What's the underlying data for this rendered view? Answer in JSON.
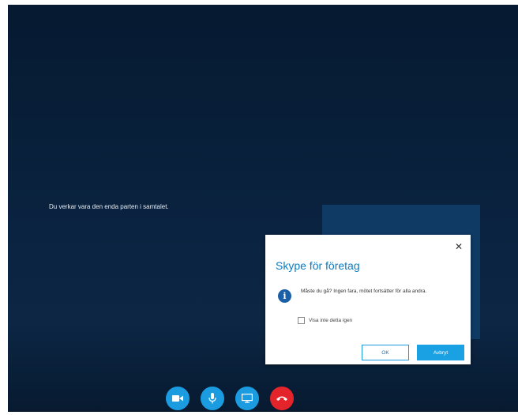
{
  "call": {
    "solo_message": "Du verkar vara den enda parten i samtalet."
  },
  "dialog": {
    "title": "Skype för företag",
    "message": "Måste du gå? Ingen fara, mötet fortsätter för alla andra.",
    "checkbox_label": "Visa inte detta igen",
    "ok_label": "OK",
    "cancel_label": "Avbryt",
    "close_icon": "close-icon",
    "info_icon": "info-icon"
  },
  "controls": {
    "video_icon": "video-camera-icon",
    "mic_icon": "microphone-icon",
    "share_icon": "present-screen-icon",
    "hangup_icon": "hang-up-icon"
  },
  "colors": {
    "accent": "#1b9ce1",
    "hangup": "#e3242b",
    "title": "#0a7bc1"
  }
}
